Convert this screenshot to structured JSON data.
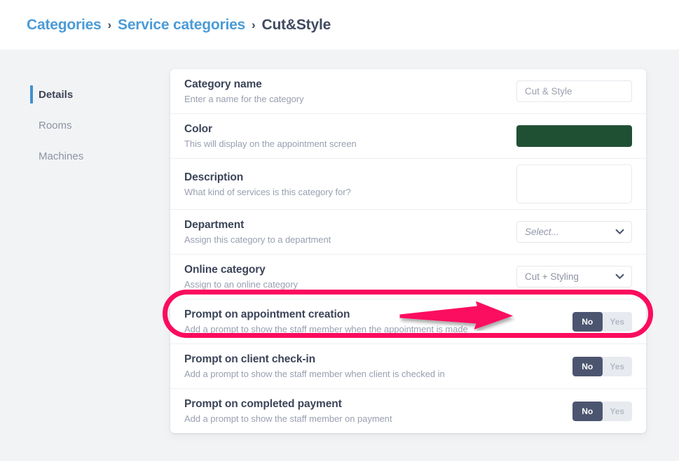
{
  "breadcrumb": {
    "items": [
      {
        "label": "Categories",
        "type": "link"
      },
      {
        "label": "Service categories",
        "type": "link"
      },
      {
        "label": "Cut&Style",
        "type": "current"
      }
    ],
    "separator": "›"
  },
  "sidebar": {
    "items": [
      {
        "label": "Details",
        "active": true
      },
      {
        "label": "Rooms",
        "active": false
      },
      {
        "label": "Machines",
        "active": false
      }
    ]
  },
  "form": {
    "rows": [
      {
        "title": "Category name",
        "subtitle": "Enter a name for the category",
        "control": "text",
        "value": "Cut & Style",
        "placeholder": "Cut & Style"
      },
      {
        "title": "Color",
        "subtitle": "This will display on the appointment screen",
        "control": "color",
        "value": "#205034"
      },
      {
        "title": "Description",
        "subtitle": "What kind of services is this category for?",
        "control": "textarea",
        "value": "",
        "placeholder": ""
      },
      {
        "title": "Department",
        "subtitle": "Assign this category to a department",
        "control": "select",
        "value": "Select...",
        "is_placeholder": true
      },
      {
        "title": "Online category",
        "subtitle": "Assign to an online category",
        "control": "select",
        "value": "Cut + Styling",
        "is_placeholder": false,
        "highlighted": true
      },
      {
        "title": "Prompt on appointment creation",
        "subtitle": "Add a prompt to show the staff member when the appointment is made",
        "control": "toggle",
        "options": [
          "No",
          "Yes"
        ],
        "selected": "No"
      },
      {
        "title": "Prompt on client check-in",
        "subtitle": "Add a prompt to show the staff member when client is checked in",
        "control": "toggle",
        "options": [
          "No",
          "Yes"
        ],
        "selected": "No"
      },
      {
        "title": "Prompt on completed payment",
        "subtitle": "Add a prompt to show the staff member on payment",
        "control": "toggle",
        "options": [
          "No",
          "Yes"
        ],
        "selected": "No"
      }
    ]
  },
  "annotation": {
    "highlight_color": "#fb0b5e",
    "arrow_color": "#fb0b5e",
    "target": "Online category"
  },
  "colors": {
    "accent_blue": "#4090ce",
    "link_blue": "#4a9bd8",
    "category_color": "#205034",
    "toggle_active": "#4c5570",
    "annotation_pink": "#fb0b5e"
  }
}
